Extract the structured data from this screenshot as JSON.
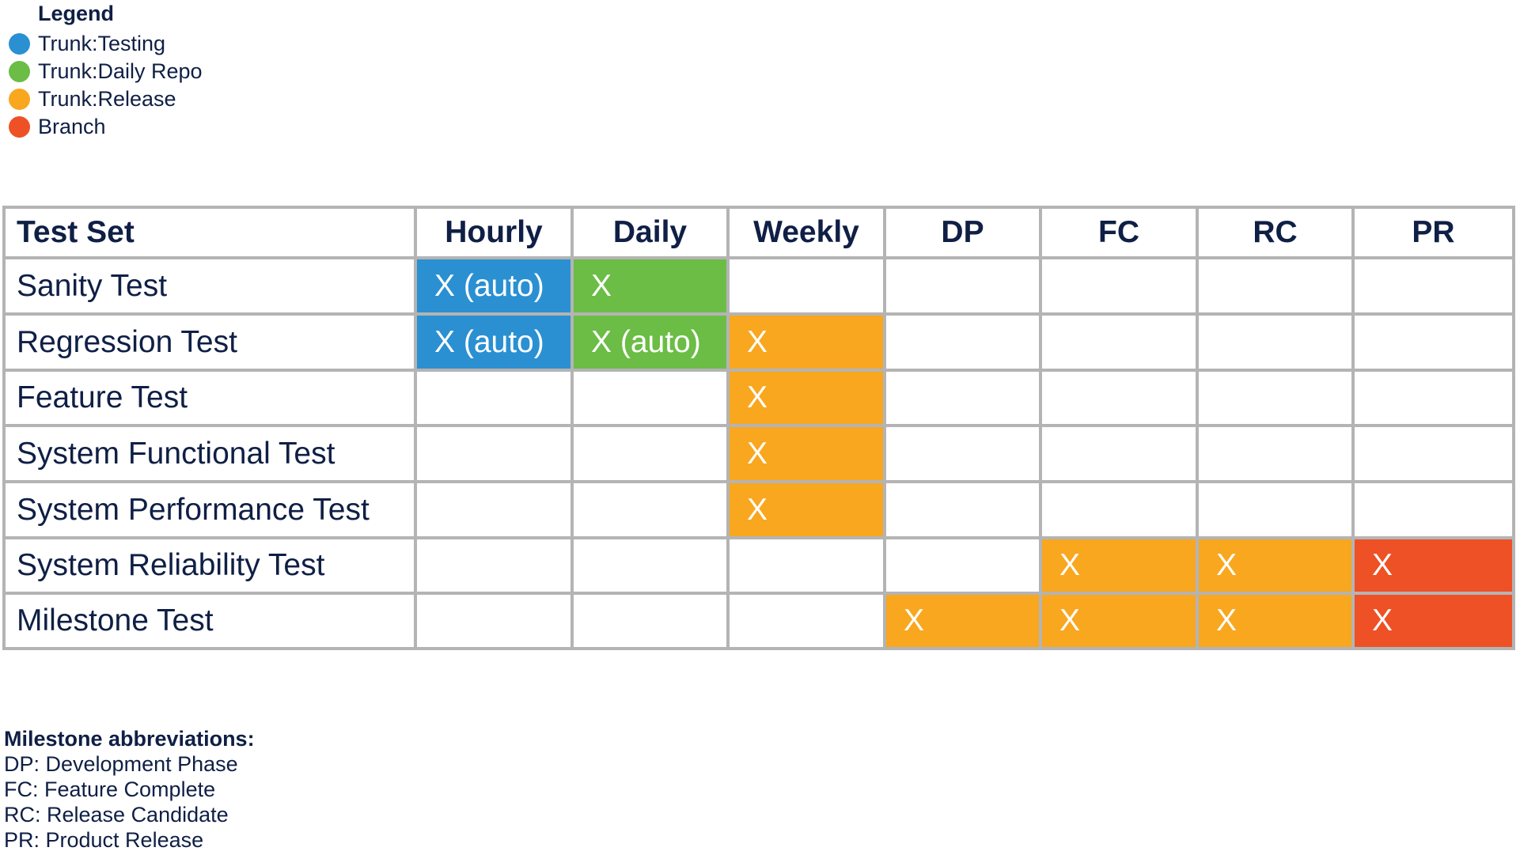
{
  "legend": {
    "title": "Legend",
    "items": [
      {
        "label": "Trunk:Testing",
        "color": "#2a90d2",
        "key": "testing"
      },
      {
        "label": "Trunk:Daily Repo",
        "color": "#6bbd45",
        "key": "daily"
      },
      {
        "label": "Trunk:Release",
        "color": "#f8a71f",
        "key": "release"
      },
      {
        "label": "Branch",
        "color": "#ee5125",
        "key": "branch"
      }
    ]
  },
  "table": {
    "headers": [
      "Test Set",
      "Hourly",
      "Daily",
      "Weekly",
      "DP",
      "FC",
      "RC",
      "PR"
    ],
    "rows": [
      {
        "name": "Sanity Test",
        "cells": [
          {
            "text": "X (auto)",
            "kind": "testing"
          },
          {
            "text": "X",
            "kind": "daily"
          },
          {
            "text": "",
            "kind": ""
          },
          {
            "text": "",
            "kind": ""
          },
          {
            "text": "",
            "kind": ""
          },
          {
            "text": "",
            "kind": ""
          },
          {
            "text": "",
            "kind": ""
          }
        ]
      },
      {
        "name": "Regression Test",
        "cells": [
          {
            "text": "X (auto)",
            "kind": "testing"
          },
          {
            "text": "X (auto)",
            "kind": "daily"
          },
          {
            "text": "X",
            "kind": "release"
          },
          {
            "text": "",
            "kind": ""
          },
          {
            "text": "",
            "kind": ""
          },
          {
            "text": "",
            "kind": ""
          },
          {
            "text": "",
            "kind": ""
          }
        ]
      },
      {
        "name": "Feature Test",
        "cells": [
          {
            "text": "",
            "kind": ""
          },
          {
            "text": "",
            "kind": ""
          },
          {
            "text": "X",
            "kind": "release"
          },
          {
            "text": "",
            "kind": ""
          },
          {
            "text": "",
            "kind": ""
          },
          {
            "text": "",
            "kind": ""
          },
          {
            "text": "",
            "kind": ""
          }
        ]
      },
      {
        "name": "System Functional Test",
        "cells": [
          {
            "text": "",
            "kind": ""
          },
          {
            "text": "",
            "kind": ""
          },
          {
            "text": "X",
            "kind": "release"
          },
          {
            "text": "",
            "kind": ""
          },
          {
            "text": "",
            "kind": ""
          },
          {
            "text": "",
            "kind": ""
          },
          {
            "text": "",
            "kind": ""
          }
        ]
      },
      {
        "name": "System Performance Test",
        "cells": [
          {
            "text": "",
            "kind": ""
          },
          {
            "text": "",
            "kind": ""
          },
          {
            "text": "X",
            "kind": "release"
          },
          {
            "text": "",
            "kind": ""
          },
          {
            "text": "",
            "kind": ""
          },
          {
            "text": "",
            "kind": ""
          },
          {
            "text": "",
            "kind": ""
          }
        ]
      },
      {
        "name": "System Reliability Test",
        "cells": [
          {
            "text": "",
            "kind": ""
          },
          {
            "text": "",
            "kind": ""
          },
          {
            "text": "",
            "kind": ""
          },
          {
            "text": "",
            "kind": ""
          },
          {
            "text": "X",
            "kind": "release"
          },
          {
            "text": "X",
            "kind": "release"
          },
          {
            "text": "X",
            "kind": "branch"
          }
        ]
      },
      {
        "name": "Milestone Test",
        "cells": [
          {
            "text": "",
            "kind": ""
          },
          {
            "text": "",
            "kind": ""
          },
          {
            "text": "",
            "kind": ""
          },
          {
            "text": "X",
            "kind": "release"
          },
          {
            "text": "X",
            "kind": "release"
          },
          {
            "text": "X",
            "kind": "release"
          },
          {
            "text": "X",
            "kind": "branch"
          }
        ]
      }
    ]
  },
  "abbreviations": {
    "title": "Milestone abbreviations:",
    "lines": [
      "DP: Development Phase",
      "FC: Feature Complete",
      "RC: Release Candidate",
      "PR: Product Release"
    ]
  },
  "colors": {
    "text": "#0f1f45",
    "grid": "#b4b4b4",
    "testing": "#2a90d2",
    "daily": "#6bbd45",
    "release": "#f8a71f",
    "branch": "#ee5125"
  }
}
